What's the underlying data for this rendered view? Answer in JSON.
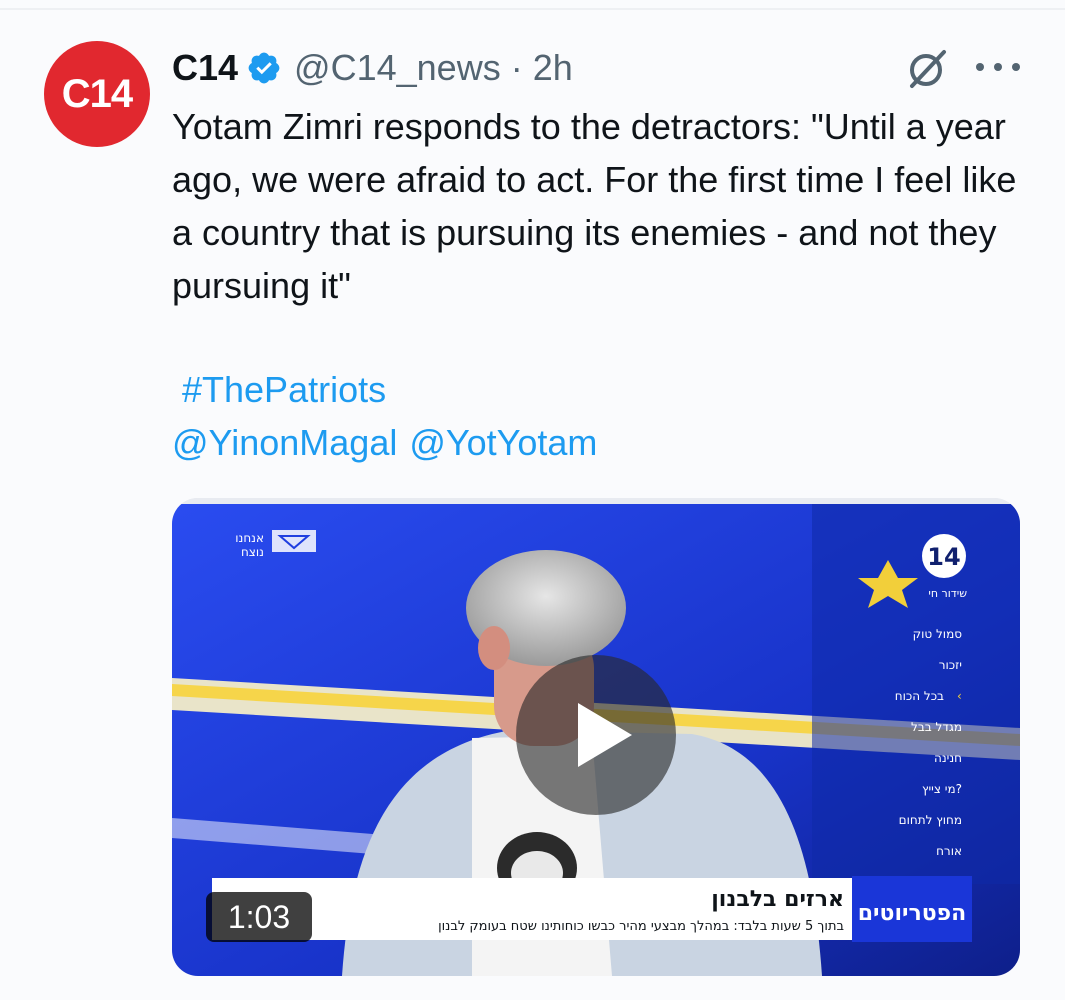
{
  "tweet": {
    "avatar_text": "C14",
    "name": "C14",
    "handle": "@C14_news",
    "separator": "·",
    "time": "2h",
    "text": "Yotam Zimri responds to the detractors: \"Until a year ago, we were afraid to act. For the first time I feel like a country that is pursuing its enemies - and not they pursuing it\"",
    "hashtag": "#ThePatriots",
    "mentions": [
      "@YinonMagal",
      "@YotYotam"
    ]
  },
  "icons": {
    "verified": "verified-badge-icon",
    "grok": "grok-icon",
    "more": "more-dots-icon",
    "play": "play-icon"
  },
  "video": {
    "duration": "1:03",
    "channel_number": "14",
    "channel_sub": "שידור חי",
    "corner_logo": [
      "אנחנו",
      "נוצח"
    ],
    "menu_items": [
      "סמול טוק",
      "יזכור",
      "בכל הכוח",
      "מגדל בבל",
      "חנינה",
      "מי צייץ?",
      "מחוץ לתחום",
      "אורח"
    ],
    "headline": "ארזים בלבנון",
    "subline": "בתוך 5 שעות בלבד: במהלך מבצעי מהיר כבשו כוחותינו שטח בעומק לבנון",
    "show_logo": "הפטריוטים"
  },
  "colors": {
    "brand_red": "#e1282f",
    "link_blue": "#1d9bf0",
    "verified_blue": "#1d9bf0",
    "studio_blue": "#1f3ee0"
  }
}
